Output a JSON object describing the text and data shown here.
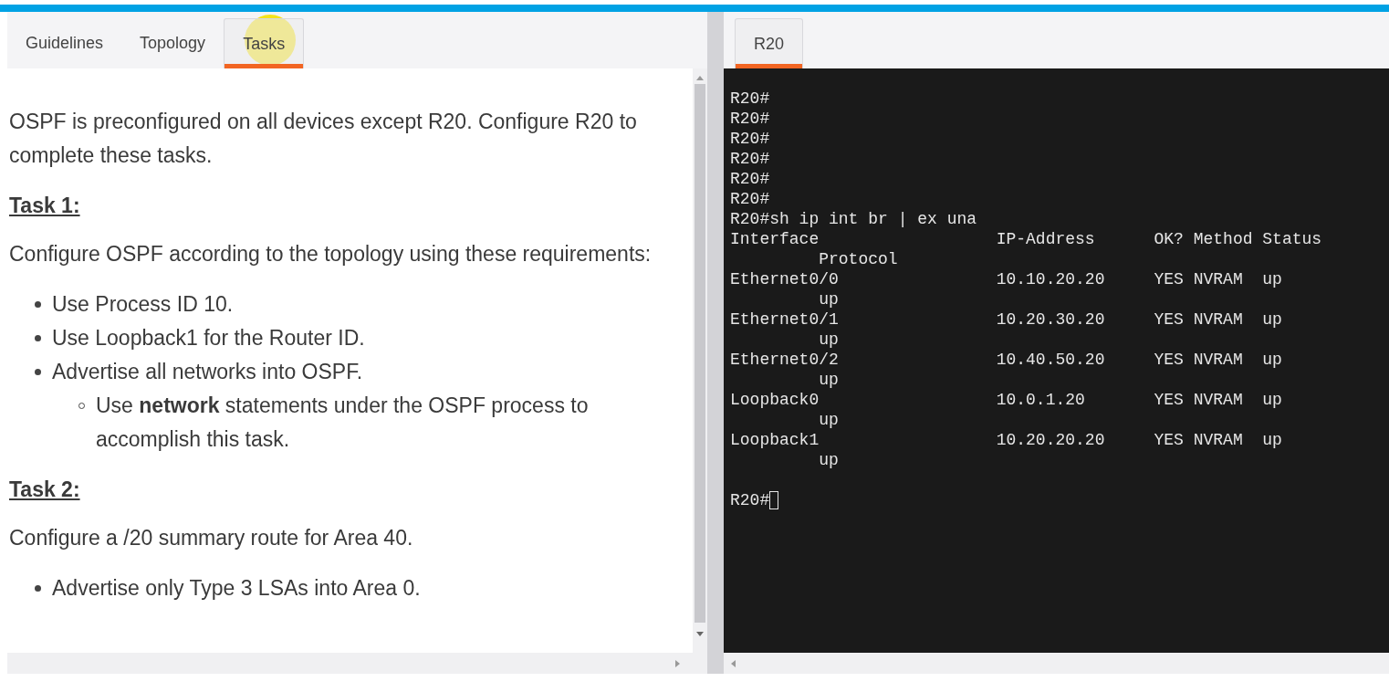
{
  "left_tabs": [
    {
      "label": "Guidelines",
      "selected": false
    },
    {
      "label": "Topology",
      "selected": false
    },
    {
      "label": "Tasks",
      "selected": true
    }
  ],
  "content": [
    {
      "kind": "paragraph",
      "text": "OSPF is preconfigured on all devices except R20. Configure R20 to complete these tasks."
    },
    {
      "kind": "heading",
      "text": "Task 1:"
    },
    {
      "kind": "paragraph",
      "text": "Configure OSPF according to the topology using these requirements:"
    },
    {
      "kind": "list",
      "items": [
        {
          "text": "Use Process ID 10."
        },
        {
          "text": "Use Loopback1 for the Router ID."
        },
        {
          "text": "Advertise all networks into OSPF.",
          "children": [
            {
              "text": "Use **network** statements under the OSPF process to accomplish this task."
            }
          ]
        }
      ]
    },
    {
      "kind": "heading",
      "text": "Task 2:"
    },
    {
      "kind": "paragraph",
      "text": "Configure a /20 summary route for Area 40."
    },
    {
      "kind": "list",
      "items": [
        {
          "text": "Advertise only Type 3 LSAs into Area 0."
        }
      ]
    }
  ],
  "right_tabs": [
    {
      "label": "R20",
      "selected": true
    }
  ],
  "terminal": {
    "lines": [
      "R20#",
      "R20#",
      "R20#",
      "R20#",
      "R20#",
      "R20#",
      "R20#sh ip int br | ex una",
      "Interface                  IP-Address      OK? Method Status",
      "         Protocol",
      "Ethernet0/0                10.10.20.20     YES NVRAM  up",
      "         up",
      "Ethernet0/1                10.20.30.20     YES NVRAM  up",
      "         up",
      "Ethernet0/2                10.40.50.20     YES NVRAM  up",
      "         up",
      "Loopback0                  10.0.1.20       YES NVRAM  up",
      "         up",
      "Loopback1                  10.20.20.20     YES NVRAM  up",
      "         up"
    ],
    "prompt": "R20#"
  }
}
